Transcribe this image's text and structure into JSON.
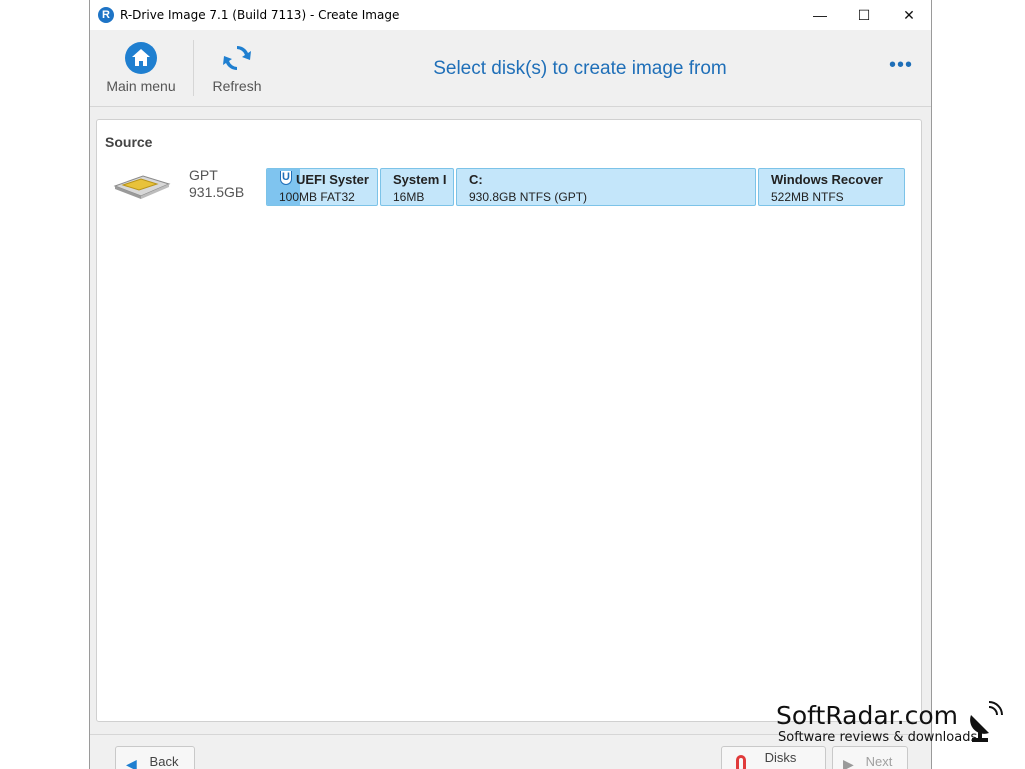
{
  "window": {
    "title": "R-Drive Image 7.1 (Build 7113) - Create Image",
    "app_icon_letter": "R",
    "minimize": "—",
    "maximize": "☐",
    "close": "✕"
  },
  "toolbar": {
    "main_menu_label": "Main menu",
    "refresh_label": "Refresh",
    "heading": "Select disk(s) to create image from",
    "more": "•••"
  },
  "source": {
    "label": "Source",
    "disk": {
      "type": "GPT",
      "size": "931.5GB"
    },
    "partitions": [
      {
        "name": "UEFI Syster",
        "info": "100MB FAT32",
        "marker": "U",
        "used_fraction": 0.3
      },
      {
        "name": "System I",
        "info": "16MB"
      },
      {
        "name": "C:",
        "info": "930.8GB NTFS (GPT)"
      },
      {
        "name": "Windows Recover",
        "info": "522MB NTFS"
      }
    ]
  },
  "bottom": {
    "back_label": "Back",
    "disks_label": "Disks",
    "next_label": "Next"
  },
  "watermark": {
    "main": "SoftRadar.com",
    "sub": "Software reviews & downloads"
  },
  "colors": {
    "accent": "#1f6fb8",
    "partition_fill": "#c4e6fa",
    "partition_border": "#7cc3e8"
  }
}
